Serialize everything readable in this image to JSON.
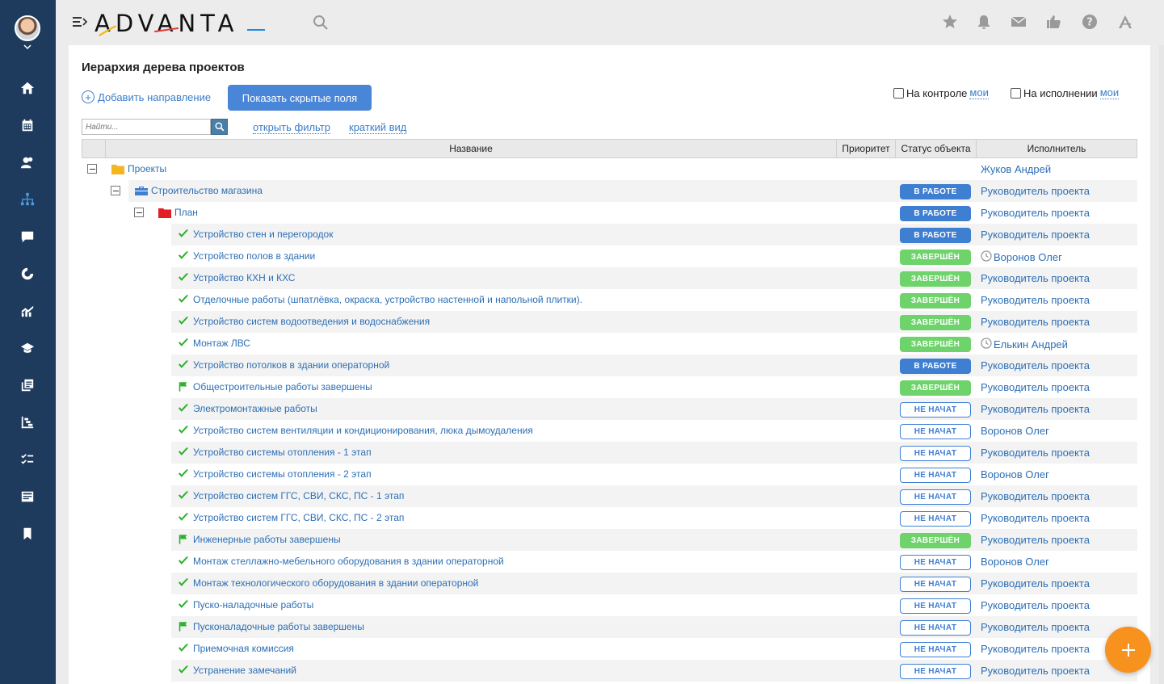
{
  "app": {
    "logo": "ADVANTA"
  },
  "page": {
    "title": "Иерархия дерева проектов"
  },
  "toolbar": {
    "add_direction": "Добавить направление",
    "show_hidden": "Показать скрытые поля",
    "on_control": "На контроле",
    "on_control_link": "мои",
    "on_execution": "На исполнении",
    "on_execution_link": "мои"
  },
  "search": {
    "placeholder": "Найти..."
  },
  "filter": {
    "open_filter": "открыть фильтр",
    "short_view": "краткий вид"
  },
  "table": {
    "columns": {
      "name": "Название",
      "priority": "Приоритет",
      "status": "Статус объекта",
      "executor": "Исполнитель"
    },
    "rows": [
      {
        "level": 0,
        "icon": "folder-yellow",
        "toggle": true,
        "name": "Проекты",
        "status": "",
        "status_type": "",
        "executor": "Жуков Андрей",
        "clock": false,
        "shaded": false
      },
      {
        "level": 1,
        "icon": "briefcase",
        "toggle": true,
        "name": "Строительство магазина",
        "status": "В РАБОТЕ",
        "status_type": "work",
        "executor": "Руководитель проекта",
        "clock": false,
        "shaded": true
      },
      {
        "level": 2,
        "icon": "folder-red",
        "toggle": true,
        "name": "План",
        "status": "В РАБОТЕ",
        "status_type": "work",
        "executor": "Руководитель проекта",
        "clock": false,
        "shaded": false
      },
      {
        "level": 3,
        "icon": "check",
        "toggle": false,
        "name": "Устройство стен и перегородок",
        "status": "В РАБОТЕ",
        "status_type": "work",
        "executor": "Руководитель проекта",
        "clock": false,
        "shaded": true
      },
      {
        "level": 3,
        "icon": "check",
        "toggle": false,
        "name": "Устройство полов в здании",
        "status": "ЗАВЕРШЁН",
        "status_type": "done",
        "executor": "Воронов Олег",
        "clock": true,
        "shaded": false
      },
      {
        "level": 3,
        "icon": "check",
        "toggle": false,
        "name": "Устройство КХН и КХС",
        "status": "ЗАВЕРШЁН",
        "status_type": "done",
        "executor": "Руководитель проекта",
        "clock": false,
        "shaded": true
      },
      {
        "level": 3,
        "icon": "check",
        "toggle": false,
        "name": "Отделочные работы (шпатлёвка, окраска, устройство настенной и напольной плитки).",
        "status": "ЗАВЕРШЁН",
        "status_type": "done",
        "executor": "Руководитель проекта",
        "clock": false,
        "shaded": false
      },
      {
        "level": 3,
        "icon": "check",
        "toggle": false,
        "name": "Устройство систем водоотведения и водоснабжения",
        "status": "ЗАВЕРШЁН",
        "status_type": "done",
        "executor": "Руководитель проекта",
        "clock": false,
        "shaded": true
      },
      {
        "level": 3,
        "icon": "check",
        "toggle": false,
        "name": "Монтаж ЛВС",
        "status": "ЗАВЕРШЁН",
        "status_type": "done",
        "executor": "Елькин Андрей",
        "clock": true,
        "shaded": false
      },
      {
        "level": 3,
        "icon": "check",
        "toggle": false,
        "name": "Устройство потолков в здании операторной",
        "status": "В РАБОТЕ",
        "status_type": "work",
        "executor": "Руководитель проекта",
        "clock": false,
        "shaded": true
      },
      {
        "level": 3,
        "icon": "flag",
        "toggle": false,
        "name": "Общестроительные работы завершены",
        "status": "ЗАВЕРШЁН",
        "status_type": "done",
        "executor": "Руководитель проекта",
        "clock": false,
        "shaded": false
      },
      {
        "level": 3,
        "icon": "check",
        "toggle": false,
        "name": "Электромонтажные работы",
        "status": "НЕ НАЧАТ",
        "status_type": "new",
        "executor": "Руководитель проекта",
        "clock": false,
        "shaded": true
      },
      {
        "level": 3,
        "icon": "check",
        "toggle": false,
        "name": "Устройство систем вентиляции и кондиционирования, люка дымоудаления",
        "status": "НЕ НАЧАТ",
        "status_type": "new",
        "executor": "Воронов Олег",
        "clock": false,
        "shaded": false
      },
      {
        "level": 3,
        "icon": "check",
        "toggle": false,
        "name": "Устройство системы отопления - 1 этап",
        "status": "НЕ НАЧАТ",
        "status_type": "new",
        "executor": "Руководитель проекта",
        "clock": false,
        "shaded": true
      },
      {
        "level": 3,
        "icon": "check",
        "toggle": false,
        "name": "Устройство системы отопления - 2 этап",
        "status": "НЕ НАЧАТ",
        "status_type": "new",
        "executor": "Воронов Олег",
        "clock": false,
        "shaded": false
      },
      {
        "level": 3,
        "icon": "check",
        "toggle": false,
        "name": "Устройство систем ГГС, СВИ, СКС, ПС - 1 этап",
        "status": "НЕ НАЧАТ",
        "status_type": "new",
        "executor": "Руководитель проекта",
        "clock": false,
        "shaded": true
      },
      {
        "level": 3,
        "icon": "check",
        "toggle": false,
        "name": "Устройство систем ГГС, СВИ, СКС, ПС - 2 этап",
        "status": "НЕ НАЧАТ",
        "status_type": "new",
        "executor": "Руководитель проекта",
        "clock": false,
        "shaded": false
      },
      {
        "level": 3,
        "icon": "flag",
        "toggle": false,
        "name": "Инженерные работы завершены",
        "status": "ЗАВЕРШЁН",
        "status_type": "done",
        "executor": "Руководитель проекта",
        "clock": false,
        "shaded": true
      },
      {
        "level": 3,
        "icon": "check",
        "toggle": false,
        "name": "Монтаж стеллажно-мебельного оборудования в здании операторной",
        "status": "НЕ НАЧАТ",
        "status_type": "new",
        "executor": "Воронов Олег",
        "clock": false,
        "shaded": false
      },
      {
        "level": 3,
        "icon": "check",
        "toggle": false,
        "name": "Монтаж технологического оборудования в здании операторной",
        "status": "НЕ НАЧАТ",
        "status_type": "new",
        "executor": "Руководитель проекта",
        "clock": false,
        "shaded": true
      },
      {
        "level": 3,
        "icon": "check",
        "toggle": false,
        "name": "Пуско-наладочные работы",
        "status": "НЕ НАЧАТ",
        "status_type": "new",
        "executor": "Руководитель проекта",
        "clock": false,
        "shaded": false
      },
      {
        "level": 3,
        "icon": "flag",
        "toggle": false,
        "name": "Пусконаладочные работы завершены",
        "status": "НЕ НАЧАТ",
        "status_type": "new",
        "executor": "Руководитель проекта",
        "clock": false,
        "shaded": true
      },
      {
        "level": 3,
        "icon": "check",
        "toggle": false,
        "name": "Приемочная комиссия",
        "status": "НЕ НАЧАТ",
        "status_type": "new",
        "executor": "Руководитель проекта",
        "clock": false,
        "shaded": false
      },
      {
        "level": 3,
        "icon": "check",
        "toggle": false,
        "name": "Устранение замечаний",
        "status": "НЕ НАЧАТ",
        "status_type": "new",
        "executor": "Руководитель проекта",
        "clock": false,
        "shaded": true
      }
    ]
  },
  "colors": {
    "sidebar": "#1e3a5c",
    "accent": "#4a86d8",
    "done": "#6dd36a",
    "fab": "#f7921e"
  }
}
